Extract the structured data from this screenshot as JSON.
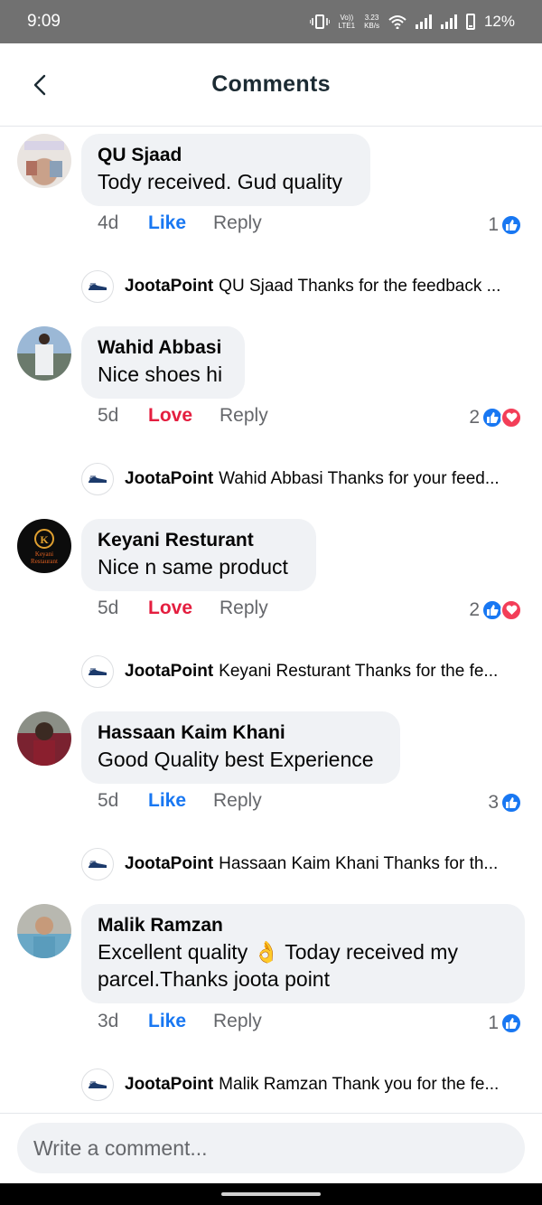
{
  "status_bar": {
    "time": "9:09",
    "network_label": "Vo))\nLTE1",
    "speed": "3.23",
    "speed_unit": "KB/s",
    "battery": "12%"
  },
  "header": {
    "title": "Comments"
  },
  "comments": [
    {
      "author": "QU Sjaad",
      "text": "Tody received. Gud quality",
      "age": "4d",
      "reaction_label": "Like",
      "reply_label": "Reply",
      "reaction_count": "1",
      "reactions": [
        "like"
      ],
      "page_reply": {
        "author": "JootaPoint",
        "text": "QU Sjaad Thanks for the feedback ..."
      }
    },
    {
      "author": "Wahid Abbasi",
      "text": "Nice shoes hi",
      "age": "5d",
      "reaction_label": "Love",
      "reply_label": "Reply",
      "reaction_count": "2",
      "reactions": [
        "like",
        "love"
      ],
      "page_reply": {
        "author": "JootaPoint",
        "text": "Wahid Abbasi Thanks for your feed..."
      }
    },
    {
      "author": "Keyani Resturant",
      "text": "Nice n same product",
      "age": "5d",
      "reaction_label": "Love",
      "reply_label": "Reply",
      "reaction_count": "2",
      "reactions": [
        "like",
        "love"
      ],
      "avatar_text": "Keyani Restaurant",
      "page_reply": {
        "author": "JootaPoint",
        "text": "Keyani Resturant Thanks for the fe..."
      }
    },
    {
      "author": "Hassaan Kaim Khani",
      "text": "Good Quality best Experience",
      "age": "5d",
      "reaction_label": "Like",
      "reply_label": "Reply",
      "reaction_count": "3",
      "reactions": [
        "like"
      ],
      "page_reply": {
        "author": "JootaPoint",
        "text": "Hassaan Kaim Khani Thanks for th..."
      }
    },
    {
      "author": "Malik Ramzan",
      "text_line1": "Excellent quality 👌 Today received my",
      "text_line2": "parcel.Thanks joota point",
      "age": "3d",
      "reaction_label": "Like",
      "reply_label": "Reply",
      "reaction_count": "1",
      "reactions": [
        "like"
      ],
      "page_reply": {
        "author": "JootaPoint",
        "text": "Malik Ramzan Thank you for the fe..."
      }
    }
  ],
  "composer": {
    "placeholder": "Write a comment..."
  },
  "colors": {
    "like_blue": "#1877f2",
    "love_red": "#e41e3f",
    "bubble_gray": "#f0f2f5",
    "status_gray": "#717171"
  }
}
